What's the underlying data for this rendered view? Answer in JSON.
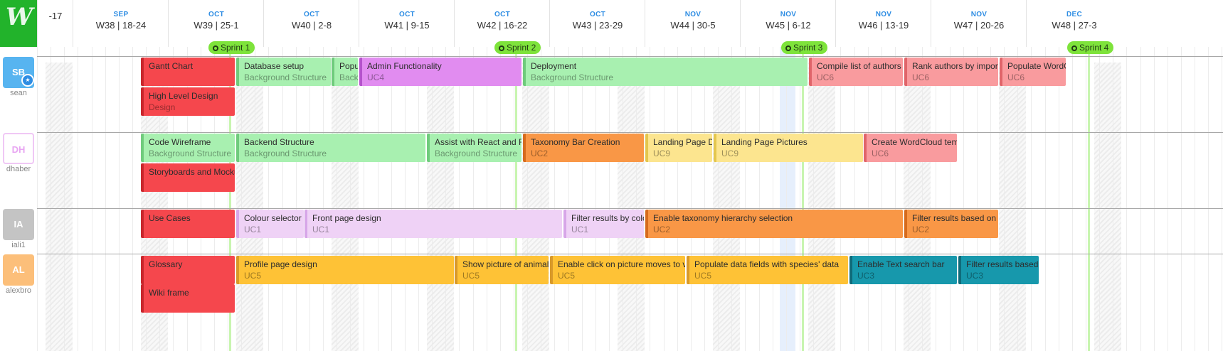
{
  "app": {
    "logo_icon": "wrike-logo",
    "logo_text": "W"
  },
  "timeline": {
    "weeks": [
      {
        "month": "",
        "label": "-17"
      },
      {
        "month": "SEP",
        "label": "W38 | 18-24"
      },
      {
        "month": "OCT",
        "label": "W39 | 25-1"
      },
      {
        "month": "OCT",
        "label": "W40 | 2-8"
      },
      {
        "month": "OCT",
        "label": "W41 | 9-15"
      },
      {
        "month": "OCT",
        "label": "W42 | 16-22"
      },
      {
        "month": "OCT",
        "label": "W43 | 23-29"
      },
      {
        "month": "NOV",
        "label": "W44 | 30-5"
      },
      {
        "month": "NOV",
        "label": "W45 | 6-12"
      },
      {
        "month": "NOV",
        "label": "W46 | 13-19"
      },
      {
        "month": "NOV",
        "label": "W47 | 20-26"
      },
      {
        "month": "DEC",
        "label": "W48 | 27-3"
      }
    ],
    "sprints": [
      "Sprint 1",
      "Sprint 2",
      "Sprint 3",
      "Sprint 4"
    ]
  },
  "colors": {
    "red": "#f5474d",
    "green": "#a8f0b0",
    "purple": "#e18cf0",
    "lavender": "#efd2f6",
    "pink": "#f99b9e",
    "orange": "#f99746",
    "yellow": "#fce58f",
    "amber": "#fec236",
    "teal": "#1798ac",
    "sprint": "#7ee33b",
    "accent": "#2e8de3",
    "logo": "#22b32b"
  },
  "users": [
    {
      "initials": "SB",
      "name": "sean",
      "color": "#57b4f0",
      "starred": true
    },
    {
      "initials": "DH",
      "name": "dhaber",
      "color": "#f0c8f5",
      "outline": true
    },
    {
      "initials": "IA",
      "name": "iali1",
      "color": "#c4c4c4"
    },
    {
      "initials": "AL",
      "name": "alexbro",
      "color": "#fcbf7a"
    }
  ],
  "tasks": [
    {
      "title": "Gantt Chart",
      "sub": "",
      "color": "red"
    },
    {
      "title": "High Level Design",
      "sub": "Design",
      "color": "red"
    },
    {
      "title": "Database setup",
      "sub": "Background Structure",
      "color": "green"
    },
    {
      "title": "Populate",
      "sub": "Background Structure",
      "color": "green"
    },
    {
      "title": "Admin Functionality",
      "sub": "UC4",
      "color": "purple"
    },
    {
      "title": "Deployment",
      "sub": "Background Structure",
      "color": "green"
    },
    {
      "title": "Compile list of authors for",
      "sub": "UC6",
      "color": "pink"
    },
    {
      "title": "Rank authors by importance",
      "sub": "UC6",
      "color": "pink"
    },
    {
      "title": "Populate WordCloud",
      "sub": "UC6",
      "color": "pink"
    },
    {
      "title": "Code Wireframe",
      "sub": "Background Structure",
      "color": "green"
    },
    {
      "title": "Storyboards and Mockups",
      "sub": "",
      "color": "red"
    },
    {
      "title": "Backend Structure",
      "sub": "Background Structure",
      "color": "green"
    },
    {
      "title": "Assist with React and Redux",
      "sub": "Background Structure",
      "color": "green"
    },
    {
      "title": "Taxonomy Bar Creation",
      "sub": "UC2",
      "color": "orange"
    },
    {
      "title": "Landing Page Design",
      "sub": "UC9",
      "color": "yellow"
    },
    {
      "title": "Landing Page Pictures",
      "sub": "UC9",
      "color": "yellow"
    },
    {
      "title": "Create WordCloud template",
      "sub": "UC6",
      "color": "pink"
    },
    {
      "title": "Use Cases",
      "sub": "",
      "color": "red"
    },
    {
      "title": "Colour selector",
      "sub": "UC1",
      "color": "lavender"
    },
    {
      "title": "Front page design",
      "sub": "UC1",
      "color": "lavender"
    },
    {
      "title": "Filter results by colour",
      "sub": "UC1",
      "color": "lavender"
    },
    {
      "title": "Enable taxonomy hierarchy selection",
      "sub": "UC2",
      "color": "orange"
    },
    {
      "title": "Filter results based on taxonomy",
      "sub": "UC2",
      "color": "orange"
    },
    {
      "title": "Glossary",
      "sub": "",
      "color": "red"
    },
    {
      "title": "Wiki frame",
      "sub": "",
      "color": "red"
    },
    {
      "title": "Profile page design",
      "sub": "UC5",
      "color": "amber"
    },
    {
      "title": "Show picture of animal on",
      "sub": "UC5",
      "color": "amber"
    },
    {
      "title": "Enable click on picture moves to view",
      "sub": "UC5",
      "color": "amber"
    },
    {
      "title": "Populate data fields with species' data",
      "sub": "UC5",
      "color": "amber"
    },
    {
      "title": "Enable Text search bar",
      "sub": "UC3",
      "color": "teal"
    },
    {
      "title": "Filter results based on",
      "sub": "UC3",
      "color": "teal"
    }
  ]
}
